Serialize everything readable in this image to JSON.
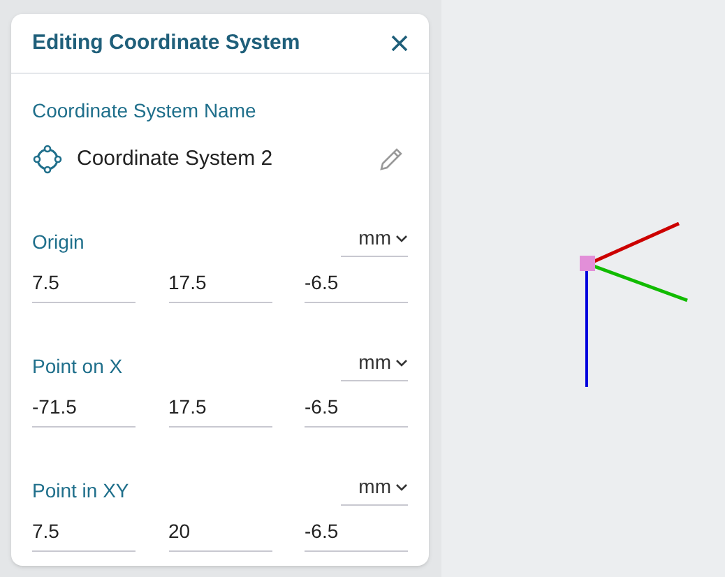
{
  "panel": {
    "title": "Editing Coordinate System",
    "name_label": "Coordinate System Name",
    "name_value": "Coordinate System 2"
  },
  "points": [
    {
      "label": "Origin",
      "unit": "mm",
      "values": [
        "7.5",
        "17.5",
        "-6.5"
      ]
    },
    {
      "label": "Point on X",
      "unit": "mm",
      "values": [
        "-71.5",
        "17.5",
        "-6.5"
      ]
    },
    {
      "label": "Point in XY",
      "unit": "mm",
      "values": [
        "7.5",
        "20",
        "-6.5"
      ]
    }
  ]
}
